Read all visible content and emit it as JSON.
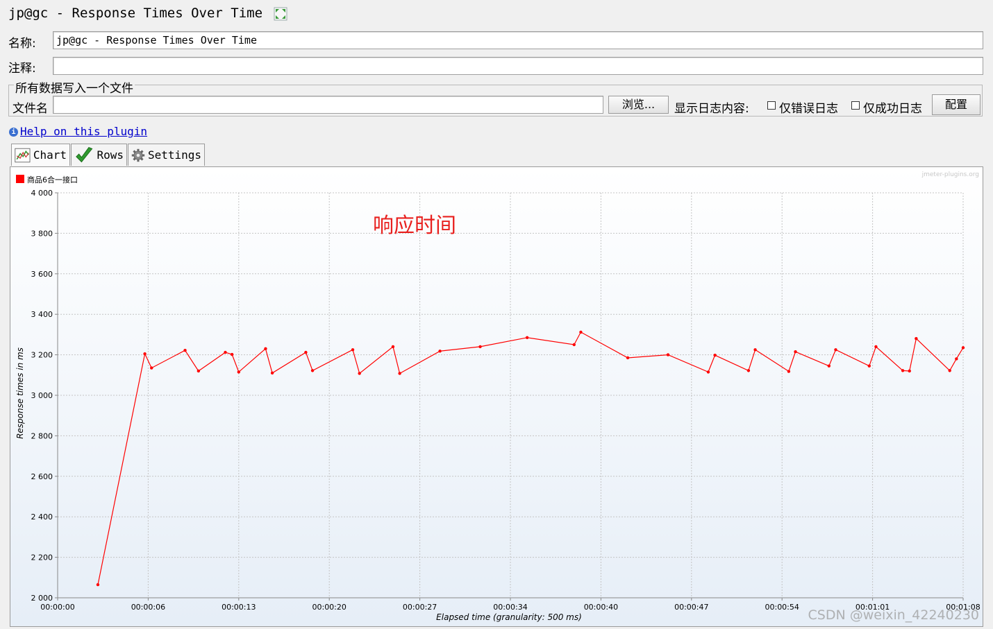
{
  "window": {
    "title": "jp@gc - Response Times Over Time"
  },
  "form": {
    "name_label": "名称:",
    "name_value": "jp@gc - Response Times Over Time",
    "comment_label": "注释:",
    "comment_value": "",
    "group_title": "所有数据写入一个文件",
    "filename_label": "文件名",
    "filename_value": "",
    "browse_button": "浏览...",
    "log_display_label": "显示日志内容:",
    "errors_only_label": "仅错误日志",
    "success_only_label": "仅成功日志",
    "configure_button": "配置"
  },
  "help": {
    "link_text": "Help on this plugin"
  },
  "tabs": [
    {
      "label": "Chart",
      "icon": "chart-icon"
    },
    {
      "label": "Rows",
      "icon": "checkmark-icon"
    },
    {
      "label": "Settings",
      "icon": "gear-icon"
    }
  ],
  "chart_watermark": "jmeter-plugins.org",
  "annotation": "响应时间",
  "page_watermark": "CSDN @weixin_42240230",
  "colors": {
    "series": "#ff0000",
    "annotation": "#e8201e"
  },
  "chart_data": {
    "type": "line",
    "title": "",
    "xlabel": "Elapsed time (granularity: 500 ms)",
    "ylabel": "Response times in ms",
    "ylim": [
      2000,
      4000
    ],
    "xlim_seconds": [
      0,
      67.5
    ],
    "x_tick_labels": [
      "00:00:00",
      "00:00:06",
      "00:00:13",
      "00:00:20",
      "00:00:27",
      "00:00:34",
      "00:00:40",
      "00:00:47",
      "00:00:54",
      "00:01:01",
      "00:01:08"
    ],
    "y_tick_labels": [
      "2 000",
      "2 200",
      "2 400",
      "2 600",
      "2 800",
      "3 000",
      "3 200",
      "3 400",
      "3 600",
      "3 800",
      "4 000"
    ],
    "grid": true,
    "legend_position": "top-left",
    "series": [
      {
        "name": "商品6合一接口",
        "x_seconds": [
          3.0,
          6.5,
          7.0,
          9.5,
          10.5,
          12.5,
          13.0,
          13.5,
          15.5,
          16.0,
          18.5,
          19.0,
          22.0,
          22.5,
          25.0,
          25.5,
          28.5,
          31.5,
          35.0,
          38.5,
          39.0,
          42.5,
          45.5,
          48.5,
          49.0,
          51.5,
          52.0,
          54.5,
          55.0,
          57.5,
          58.0,
          60.5,
          61.0,
          63.0,
          63.5,
          64.0,
          66.5,
          67.0,
          67.5
        ],
        "values": [
          2065,
          3205,
          3135,
          3222,
          3120,
          3212,
          3202,
          3115,
          3230,
          3110,
          3212,
          3122,
          3225,
          3108,
          3240,
          3108,
          3218,
          3240,
          3285,
          3250,
          3312,
          3185,
          3200,
          3115,
          3198,
          3122,
          3225,
          3118,
          3215,
          3145,
          3225,
          3145,
          3240,
          3122,
          3120,
          3280,
          3122,
          3180,
          3235
        ]
      }
    ]
  }
}
